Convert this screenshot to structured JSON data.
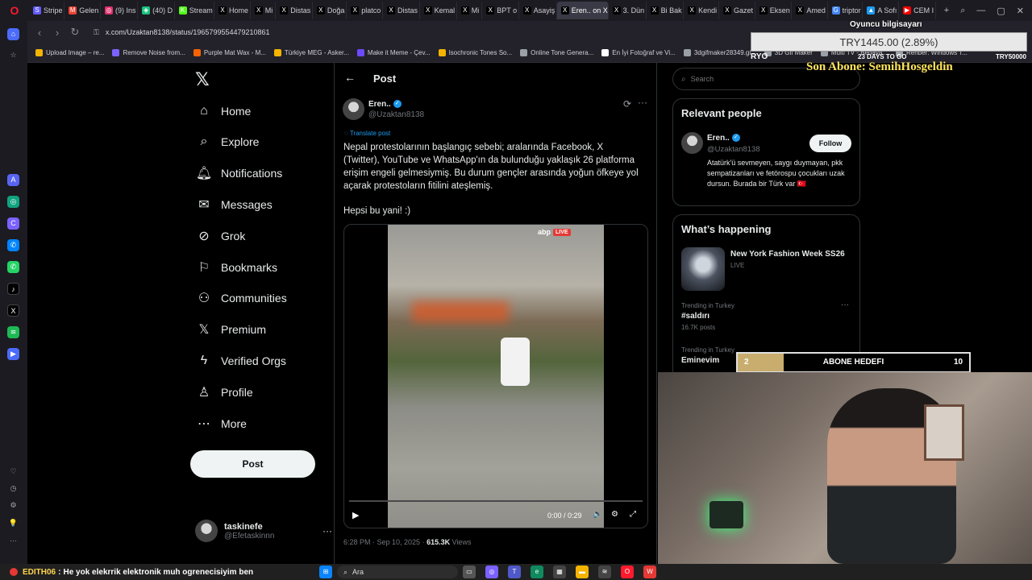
{
  "browser": {
    "tabs": [
      {
        "label": "Stripe",
        "color": "#635bff",
        "glyph": "S"
      },
      {
        "label": "Gelen",
        "color": "#ea4335",
        "glyph": "M"
      },
      {
        "label": "(9) Ins",
        "color": "#e1306c",
        "glyph": "◎"
      },
      {
        "label": "(40) D",
        "color": "#19c37d",
        "glyph": "◈"
      },
      {
        "label": "Stream",
        "color": "#53fc18",
        "glyph": "K"
      },
      {
        "label": "Home",
        "color": "#000000",
        "glyph": "X"
      },
      {
        "label": "Mi",
        "color": "#000000",
        "glyph": "X"
      },
      {
        "label": "Distas",
        "color": "#000000",
        "glyph": "X"
      },
      {
        "label": "Doğa",
        "color": "#000000",
        "glyph": "X"
      },
      {
        "label": "platco",
        "color": "#000000",
        "glyph": "X"
      },
      {
        "label": "Distas",
        "color": "#000000",
        "glyph": "X"
      },
      {
        "label": "Kemal",
        "color": "#000000",
        "glyph": "X"
      },
      {
        "label": "Mi",
        "color": "#000000",
        "glyph": "X"
      },
      {
        "label": "BPT o",
        "color": "#000000",
        "glyph": "X"
      },
      {
        "label": "Asayiş",
        "color": "#000000",
        "glyph": "X"
      },
      {
        "label": "Eren.. on X",
        "color": "#000000",
        "glyph": "X",
        "active": true
      },
      {
        "label": "3. Dün",
        "color": "#000000",
        "glyph": "X"
      },
      {
        "label": "Bi Bak",
        "color": "#000000",
        "glyph": "X"
      },
      {
        "label": "Kendi",
        "color": "#000000",
        "glyph": "X"
      },
      {
        "label": "Gazet",
        "color": "#000000",
        "glyph": "X"
      },
      {
        "label": "Eksen",
        "color": "#000000",
        "glyph": "X"
      },
      {
        "label": "Amed",
        "color": "#000000",
        "glyph": "X"
      },
      {
        "label": "triptor",
        "color": "#4285f4",
        "glyph": "G"
      },
      {
        "label": "A Sofı",
        "color": "#1d9bf0",
        "glyph": "▲"
      },
      {
        "label": "CEM I",
        "color": "#ff0000",
        "glyph": "▶"
      }
    ],
    "url": "x.com/Uzaktan8138/status/1965799554479210861",
    "bookmarks": [
      {
        "label": "Upload Image – re...",
        "color": "#f4b400"
      },
      {
        "label": "Remove Noise from...",
        "color": "#7b61ff"
      },
      {
        "label": "Purple Mat Wax - M...",
        "color": "#f96302"
      },
      {
        "label": "Türkiye MEG - Asker...",
        "color": "#f4b400"
      },
      {
        "label": "Make it Meme - Çev...",
        "color": "#6d4aff"
      },
      {
        "label": "Isochronic Tones So...",
        "color": "#f4b400"
      },
      {
        "label": "Online Tone Genera...",
        "color": "#9aa0a6"
      },
      {
        "label": "En İyi Fotoğraf ve Vi...",
        "color": "#ffffff"
      },
      {
        "label": "3dgifmaker28349.gi...",
        "color": "#9aa0a6"
      },
      {
        "label": "3D Gif Maker",
        "color": "#9aa0a6"
      },
      {
        "label": "Multi TV - Bedava...",
        "color": "#9aa0a6"
      },
      {
        "label": "Rehber: Windows T...",
        "color": "#9aa0a6"
      }
    ]
  },
  "stream_overlay": {
    "game_name": "Oyuncu bilgisayarı",
    "goal_amount": "TRY1445.00 (2.89%)",
    "goal_left": "RYO",
    "goal_days": "23 DAYS TO GO",
    "goal_right": "TRY50000",
    "last_sub": "Son Abone: SemihHosgeldin",
    "sub_goal_current": "2",
    "sub_goal_label": "ABONE HEDEFI",
    "sub_goal_target": "10",
    "sub_goal_progress": 0.2,
    "chat_user": "EDITH06",
    "chat_message": "He yok elekrrik elektronik muh ogrenecisiyim ben"
  },
  "sidebar": {
    "items": [
      {
        "label": "Home",
        "icon": "home-icon"
      },
      {
        "label": "Explore",
        "icon": "search-icon"
      },
      {
        "label": "Notifications",
        "icon": "bell-icon"
      },
      {
        "label": "Messages",
        "icon": "envelope-icon"
      },
      {
        "label": "Grok",
        "icon": "grok-icon"
      },
      {
        "label": "Bookmarks",
        "icon": "bookmark-icon"
      },
      {
        "label": "Communities",
        "icon": "people-icon"
      },
      {
        "label": "Premium",
        "icon": "x-icon"
      },
      {
        "label": "Verified Orgs",
        "icon": "lightning-icon"
      },
      {
        "label": "Profile",
        "icon": "person-icon"
      },
      {
        "label": "More",
        "icon": "more-circle-icon"
      }
    ],
    "post_button": "Post",
    "account": {
      "name": "taskinefe",
      "handle": "@Efetaskinnn",
      "more": "···"
    }
  },
  "main": {
    "header": "Post",
    "tweet": {
      "author": "Eren..",
      "handle": "@Uzaktan8138",
      "translate": "Translate post",
      "text": "Nepal protestolarının başlangıç sebebi; aralarında Facebook, X (Twitter), YouTube ve WhatsApp'ın da bulunduğu yaklaşık 26 platforma erişim engeli gelmesiymiş. Bu durum gençler arasında yoğun öfkeye yol açarak protestoların fitilini ateşlemiş.",
      "text2": "Hepsi bu yani! :)",
      "video": {
        "channel": "abp",
        "live": "LIVE",
        "time": "0:00 / 0:29",
        "progress": 0
      },
      "timestamp": "6:28 PM · Sep 10, 2025 · ",
      "views_count": "615.3K",
      "views_label": " Views"
    }
  },
  "right": {
    "search_placeholder": "Search",
    "relevant": {
      "title": "Relevant people",
      "name": "Eren..",
      "handle": "@Uzaktan8138",
      "follow": "Follow",
      "bio": "Atatürk'ü sevmeyen, saygı duymayan, pkk sempatizanları ve fetörospu çocukları uzak dursun. Burada bir Türk var 🇹🇷"
    },
    "happening": {
      "title": "What’s happening",
      "event_title": "New York Fashion Week SS26",
      "event_status": "LIVE",
      "trends": [
        {
          "context": "Trending in Turkey",
          "name": "#saldırı",
          "posts": "16.7K posts"
        },
        {
          "context": "Trending in Turkey",
          "name": "Eminevim",
          "posts": ""
        }
      ]
    }
  },
  "taskbar": {
    "search": "Ara"
  }
}
